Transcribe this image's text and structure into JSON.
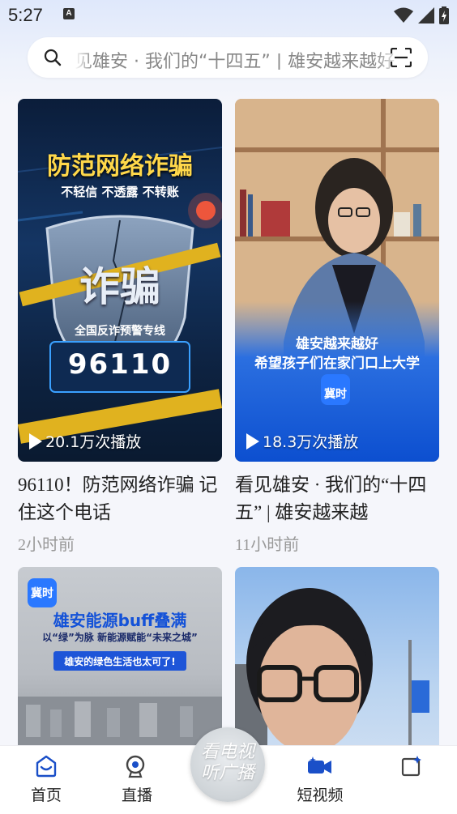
{
  "status_bar": {
    "time": "5:27",
    "notification_badge": "A"
  },
  "search": {
    "text": "见雄安 · 我们的“十四五” | 雄安越来越好"
  },
  "cards": [
    {
      "overlay_title": "防范网络诈骗",
      "overlay_subtitle": "不轻信 不透露 不转账",
      "shield_text": "诈骗",
      "hotline_label": "全国反诈预警专线",
      "hotline_number": "96110",
      "plays": "20.1万次播放",
      "title": "96110！防范网络诈骗 记住这个电话",
      "time": "2小时前"
    },
    {
      "caption_line1": "雄安越来越好",
      "caption_line2": "希望孩子们在家门口上大学",
      "logo_text": "冀时",
      "plays": "18.3万次播放",
      "title": "看见雄安 · 我们的“十四五” | 雄安越来越",
      "time": "11小时前"
    },
    {
      "logo_text": "冀时",
      "headline": "雄安能源buff叠满",
      "subline": "以“绿”为脉 新能源赋能“未来之城”",
      "tagline": "雄安的绿色生活也太可了!"
    },
    {}
  ],
  "nav": {
    "home": "首页",
    "live": "直播",
    "center_line1": "看电视",
    "center_line2": "听广播",
    "short_video": "短视频"
  }
}
